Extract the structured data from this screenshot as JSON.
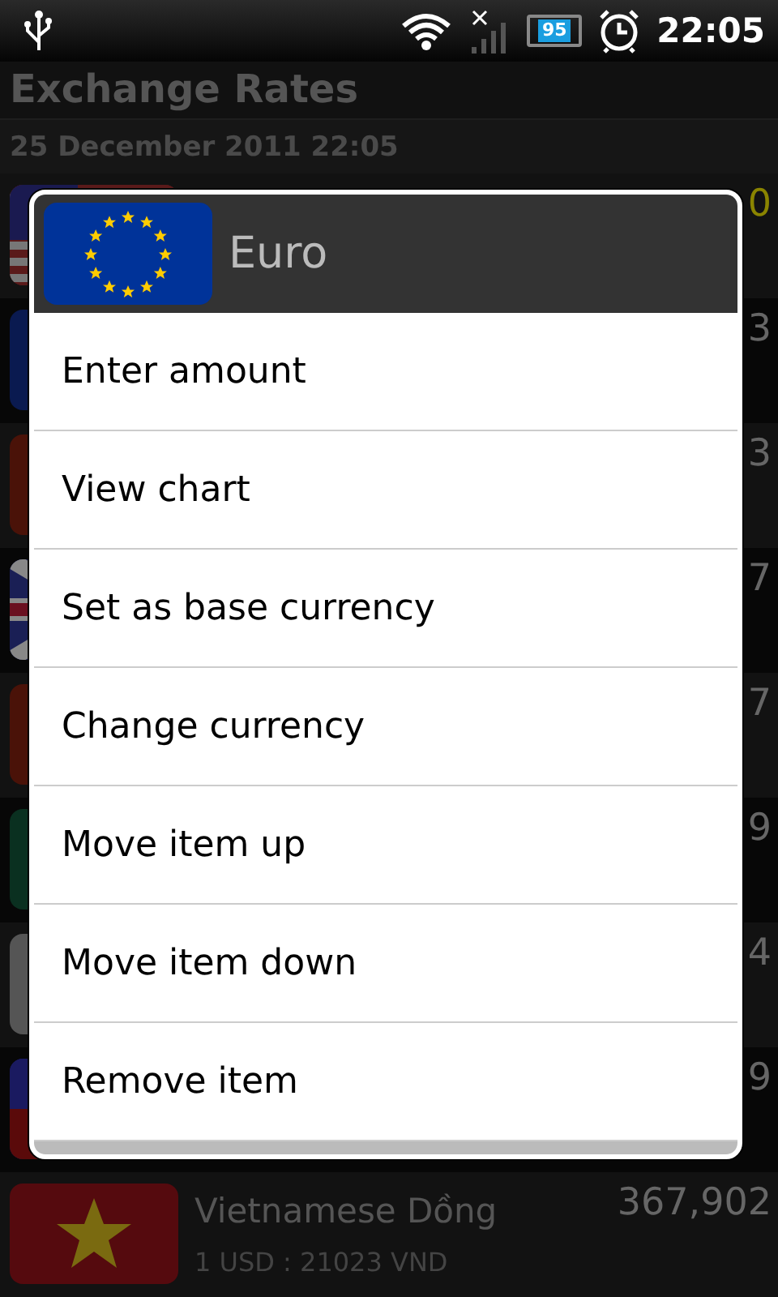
{
  "status_bar": {
    "battery": "95",
    "time": "22:05"
  },
  "app": {
    "title": "Exchange Rates",
    "subtitle": "25 December 2011 22:05"
  },
  "rows": [
    {
      "kind": "us",
      "amount": "0",
      "base": true
    },
    {
      "kind": "blue",
      "amount": "3",
      "base": false
    },
    {
      "kind": "red",
      "amount": "3",
      "base": false
    },
    {
      "kind": "uk",
      "amount": "7",
      "base": false
    },
    {
      "kind": "red",
      "amount": "7",
      "base": false
    },
    {
      "kind": "green",
      "amount": "9",
      "base": false
    },
    {
      "kind": "grey",
      "amount": "4",
      "base": false
    },
    {
      "kind": "ph",
      "amount": "9",
      "base": false
    },
    {
      "kind": "vn",
      "name": "Vietnamese Dồng",
      "amount": "367,902",
      "rate": "1 USD : 21023 VND",
      "base": false
    }
  ],
  "dialog": {
    "title": "Euro",
    "items": [
      "Enter amount",
      "View chart",
      "Set as base currency",
      "Change currency",
      "Move item up",
      "Move item down",
      "Remove item"
    ]
  }
}
